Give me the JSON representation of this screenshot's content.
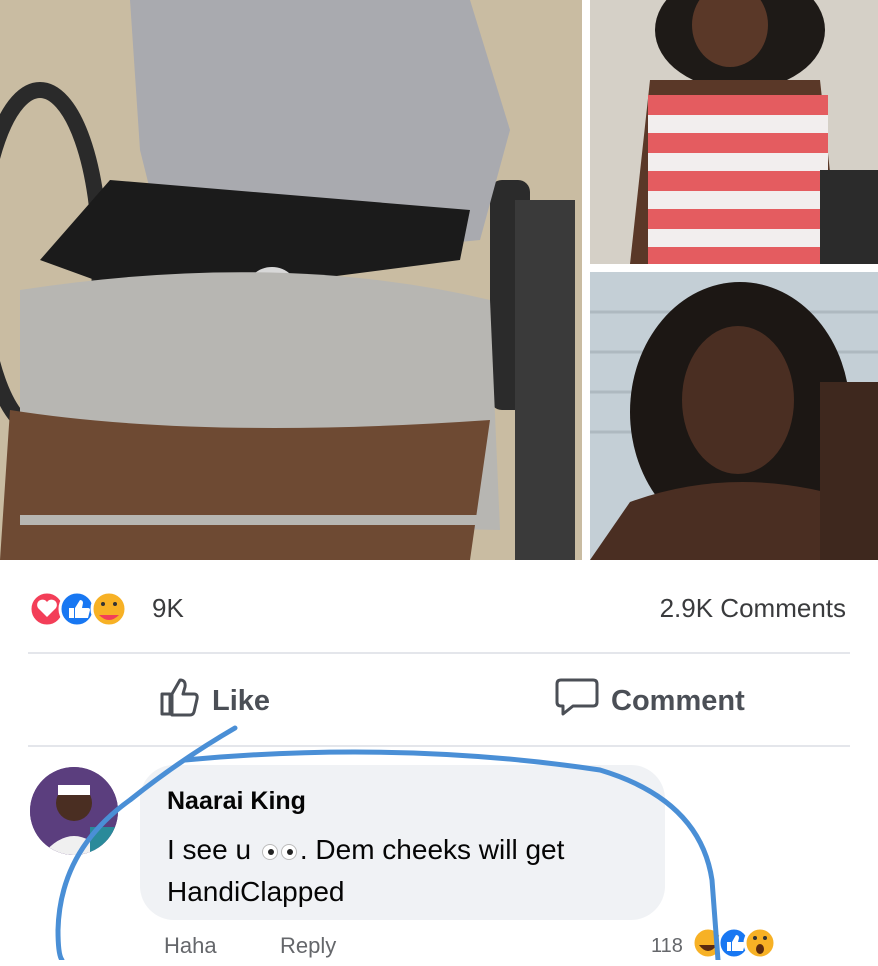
{
  "post": {
    "reaction_count": "9K",
    "comments_count": "2.9K Comments",
    "reaction_icons": [
      "love-reaction-icon",
      "like-reaction-icon",
      "care-reaction-icon"
    ]
  },
  "actions": {
    "like_label": "Like",
    "comment_label": "Comment"
  },
  "comment": {
    "author": "Naarai King",
    "text_before_emoji": "I see u ",
    "emoji": "eyes-emoji",
    "text_after_emoji": ". Dem cheeks will get HandiClapped",
    "haha_label": "Haha",
    "reply_label": "Reply",
    "reaction_count": "118",
    "reaction_icons": [
      "haha-reaction-icon",
      "like-reaction-icon",
      "wow-reaction-icon"
    ]
  },
  "colors": {
    "like_blue": "#1877f2",
    "love_red": "#f33e58",
    "annotation_blue": "#4a8fd6"
  }
}
